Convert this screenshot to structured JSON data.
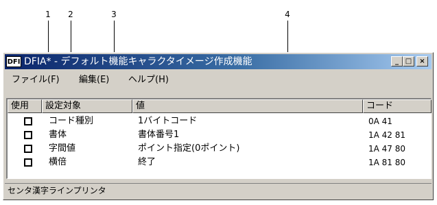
{
  "callouts": [
    "1",
    "2",
    "3",
    "4"
  ],
  "window": {
    "icon_text": "DFI",
    "title": "DFIA* - デフォルト機能キャラクタイメージ作成機能",
    "controls": {
      "minimize": "_",
      "maximize": "□",
      "close": "×"
    }
  },
  "menu": [
    "ファイル(F)",
    "編集(E)",
    "ヘルプ(H)"
  ],
  "list": {
    "headers": [
      "使用",
      "設定対象",
      "値",
      "コード"
    ],
    "rows": [
      {
        "target": "コード種別",
        "value": "1バイトコード",
        "code": "0A 41",
        "checked": false
      },
      {
        "target": "書体",
        "value": "書体番号1",
        "code": "1A 42 81",
        "checked": false
      },
      {
        "target": "字間値",
        "value": "ポイント指定(0ポイント)",
        "code": "1A 47 80",
        "checked": false
      },
      {
        "target": "横倍",
        "value": "終了",
        "code": "1A 81 80",
        "checked": false
      }
    ]
  },
  "status": "センタ漢字ラインプリンタ"
}
